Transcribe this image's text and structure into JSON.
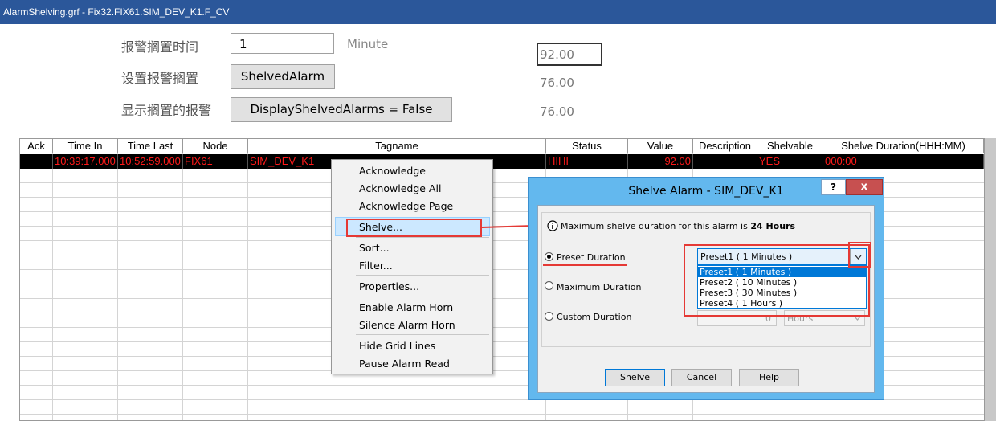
{
  "window": {
    "title": "AlarmShelving.grf - Fix32.FIX61.SIM_DEV_K1.F_CV"
  },
  "form": {
    "shelve_time_label": "报警搁置时间",
    "shelve_time_value": "1",
    "shelve_time_unit": "Minute",
    "set_shelve_label": "设置报警搁置",
    "shelve_button": "ShelvedAlarm",
    "display_shelved_label": "显示搁置的报警",
    "display_button": "DisplayShelvedAlarms = False",
    "value_box": "92.00",
    "value_2": "76.00",
    "value_3": "76.00"
  },
  "grid": {
    "columns": [
      "Ack",
      "Time In",
      "Time Last",
      "Node",
      "Tagname",
      "Status",
      "Value",
      "Description",
      "Shelvable",
      "Shelve Duration(HHH:MM)"
    ],
    "rows": [
      {
        "ack": "",
        "time_in": "10:39:17.000",
        "time_last": "10:52:59.000",
        "node": "FIX61",
        "tagname": "SIM_DEV_K1",
        "status": "HIHI",
        "value": "92.00",
        "description": "",
        "shelvable": "YES",
        "shelve_duration": "000:00"
      }
    ]
  },
  "context_menu": {
    "items": [
      "Acknowledge",
      "Acknowledge All",
      "Acknowledge Page",
      "Shelve...",
      "Sort...",
      "Filter...",
      "Properties...",
      "Enable Alarm Horn",
      "Silence Alarm Horn",
      "Hide Grid Lines",
      "Pause Alarm Read"
    ]
  },
  "dialog": {
    "title": "Shelve Alarm - SIM_DEV_K1",
    "help_glyph": "?",
    "close_glyph": "x",
    "info_text": "Maximum shelve duration for this alarm is ",
    "info_bold": "24 Hours",
    "radio_preset": "Preset Duration",
    "radio_max": "Maximum Duration",
    "radio_custom": "Custom Duration",
    "preset_selected": "Preset1 ( 1 Minutes )",
    "preset_options": [
      "Preset1 ( 1 Minutes )",
      "Preset2 ( 10 Minutes )",
      "Preset3 ( 30 Minutes )",
      "Preset4 ( 1 Hours )"
    ],
    "custom_value": "0",
    "custom_unit": "Hours",
    "buttons": {
      "shelve": "Shelve",
      "cancel": "Cancel",
      "help": "Help"
    }
  },
  "colors": {
    "titlebar": "#2b579a",
    "dialog_frame": "#63b8ee",
    "alarm_text": "#ff1a1a",
    "annotation": "#e53935",
    "selection": "#0078d7"
  }
}
